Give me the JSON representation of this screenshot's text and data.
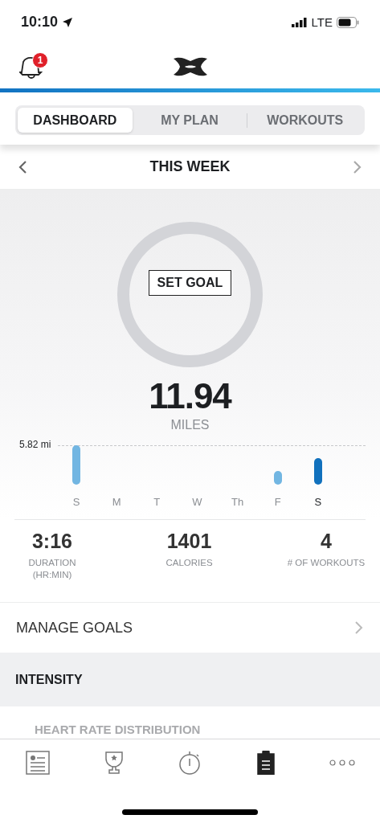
{
  "status_bar": {
    "time": "10:10",
    "network": "LTE"
  },
  "header": {
    "notification_count": "1"
  },
  "tabs": [
    {
      "label": "DASHBOARD",
      "selected": true
    },
    {
      "label": "MY PLAN",
      "selected": false
    },
    {
      "label": "WORKOUTS",
      "selected": false
    }
  ],
  "period": {
    "title": "THIS WEEK"
  },
  "goal": {
    "button": "SET GOAL"
  },
  "summary": {
    "value": "11.94",
    "unit": "MILES"
  },
  "weekly": {
    "reference": "5.82 mi",
    "days": [
      {
        "label": "S",
        "selected": false
      },
      {
        "label": "M",
        "selected": false
      },
      {
        "label": "T",
        "selected": false
      },
      {
        "label": "W",
        "selected": false
      },
      {
        "label": "Th",
        "selected": false
      },
      {
        "label": "F",
        "selected": false
      },
      {
        "label": "S",
        "selected": true
      }
    ]
  },
  "stats": [
    {
      "value": "3:16",
      "label": "DURATION",
      "sublabel": "(HR:MIN)"
    },
    {
      "value": "1401",
      "label": "CALORIES"
    },
    {
      "value": "4",
      "label": "# OF WORKOUTS"
    }
  ],
  "manage_goals": {
    "label": "MANAGE GOALS"
  },
  "intensity": {
    "title": "INTENSITY",
    "subtitle": "HEART RATE DISTRIBUTION"
  },
  "bottom_nav": [
    {
      "kind": "feed",
      "selected": false
    },
    {
      "kind": "challenges",
      "selected": false
    },
    {
      "kind": "record",
      "selected": false
    },
    {
      "kind": "training",
      "selected": true
    },
    {
      "kind": "more",
      "selected": false
    }
  ]
}
